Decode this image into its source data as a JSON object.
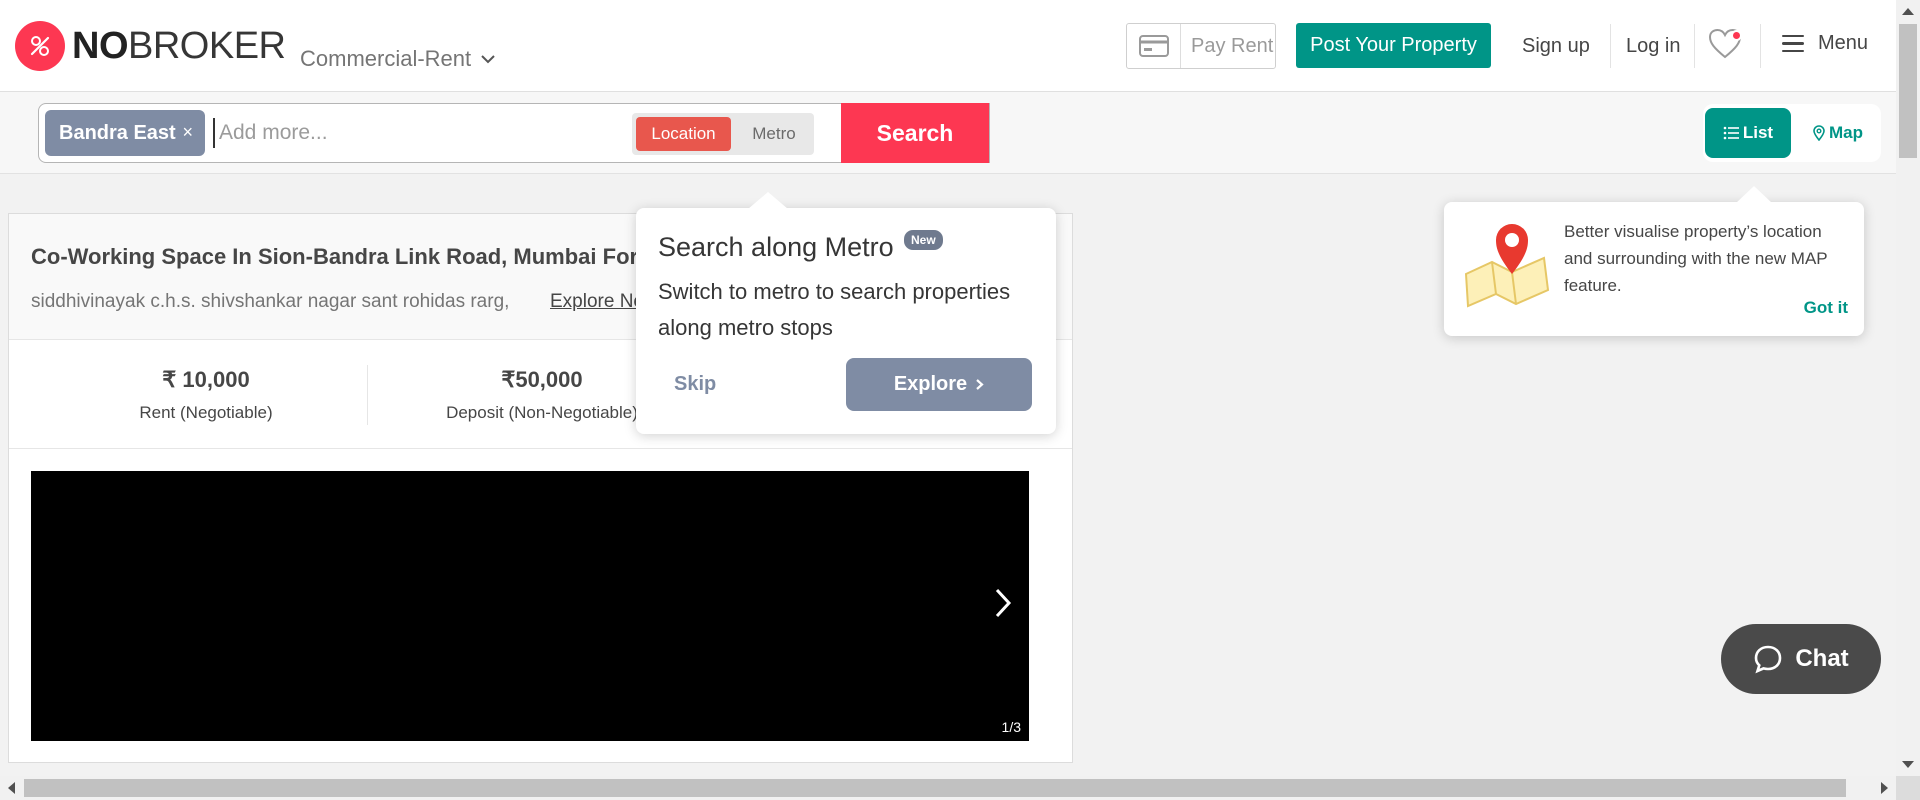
{
  "brand": {
    "name_bold": "NO",
    "name_rest": "BROKER",
    "accent": "#fd3752",
    "teal": "#009587"
  },
  "header": {
    "category": "Commercial-Rent",
    "pay_rent": "Pay Rent",
    "post_property": "Post Your Property",
    "sign_up": "Sign up",
    "log_in": "Log in",
    "menu": "Menu"
  },
  "search": {
    "chip": "Bandra East",
    "chip_close": "×",
    "placeholder": "Add more...",
    "mode_location": "Location",
    "mode_metro": "Metro",
    "button": "Search",
    "view_list": "List",
    "view_map": "Map"
  },
  "listing": {
    "title": "Co-Working Space In Sion-Bandra Link Road, Mumbai For Rent",
    "address": "siddhivinayak c.h.s. shivshankar nagar sant rohidas rarg,",
    "explore": "Explore Nearby",
    "rent_value": "₹ 10,000",
    "rent_label": "Rent (Negotiable)",
    "deposit_value": "₹50,000",
    "deposit_label": "Deposit (Non-Negotiable)",
    "gallery_counter": "1/3"
  },
  "metro_popover": {
    "title": "Search along Metro",
    "badge": "New",
    "description": "Switch to metro to search properties along metro stops",
    "skip": "Skip",
    "explore": "Explore"
  },
  "map_tooltip": {
    "text": "Better visualise property’s location and surrounding with the new MAP feature.",
    "got_it": "Got it"
  },
  "chat": {
    "label": "Chat"
  }
}
